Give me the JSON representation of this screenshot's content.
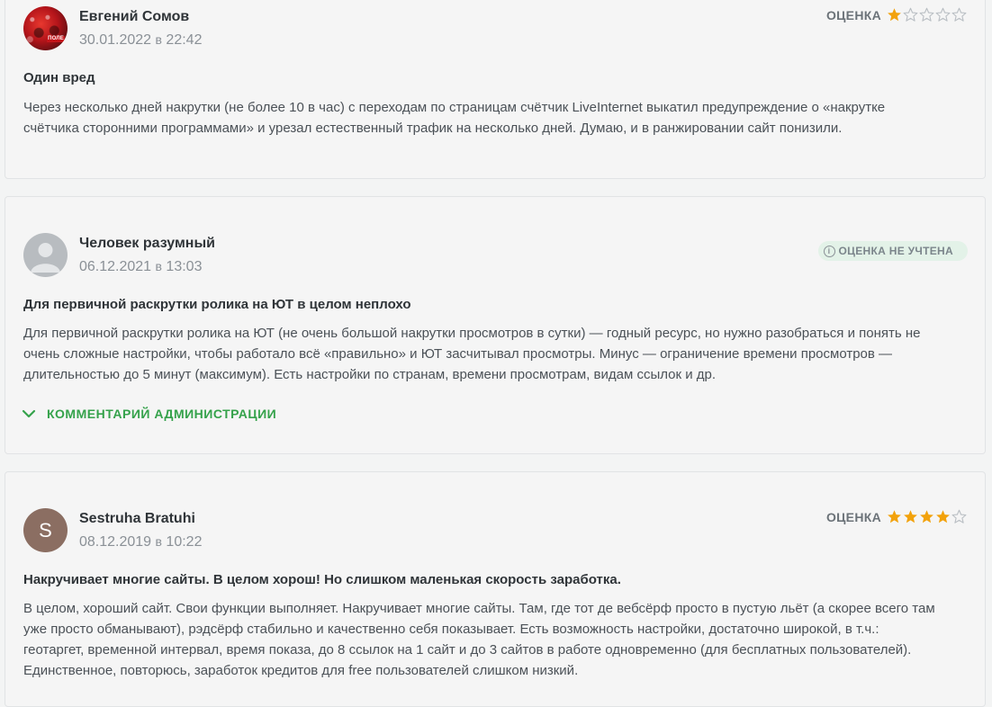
{
  "colors": {
    "star_filled": "#f2a20c",
    "star_empty": "#b9bec3",
    "accent_green": "#35a24b",
    "badge_bg": "#e3f2e8"
  },
  "reviews": [
    {
      "author": "Евгений Сомов",
      "date": "30.01.2022",
      "at": "в",
      "time": "22:42",
      "avatar": {
        "type": "photo",
        "logo_text": "ПОЛЕ"
      },
      "rating_label": "ОЦЕНКА",
      "rating": 1,
      "rating_max": 5,
      "title": "Один вред",
      "body": "Через несколько дней накрутки (не более 10 в час) с переходам по страницам счётчик LiveInternet выкатил предупреждение о «накрутке счётчика сторонними программами» и урезал естественный трафик на несколько дней. Думаю, и в ранжировании сайт понизили."
    },
    {
      "author": "Человек разумный",
      "date": "06.12.2021",
      "at": "в",
      "time": "13:03",
      "avatar": {
        "type": "anon"
      },
      "badge": "ОЦЕНКА НЕ УЧТЕНА",
      "badge_icon": "info-icon",
      "title": "Для первичной раскрутки ролика на ЮТ в целом неплохо",
      "body": "Для первичной раскрутки ролика на ЮТ (не очень большой накрутки просмотров в сутки) — годный ресурс, но нужно разобраться и понять не очень сложные настройки, чтобы работало всё «правильно» и ЮТ засчитывал просмотры. Минус — ограничение времени просмотров — длительностью до 5 минут (максимум). Есть настройки по странам, времени просмотрам, видам ссылок и др.",
      "admin_comment_label": "КОММЕНТАРИЙ АДМИНИСТРАЦИИ"
    },
    {
      "author": "Sestruha Bratuhi",
      "date": "08.12.2019",
      "at": "в",
      "time": "10:22",
      "avatar": {
        "type": "letter",
        "letter": "S"
      },
      "rating_label": "ОЦЕНКА",
      "rating": 4,
      "rating_max": 5,
      "title": "Накручивает многие сайты. В целом хорош! Но слишком маленькая скорость заработка.",
      "body": "В целом, хороший сайт. Свои функции выполняет. Накручивает многие сайты. Там, где тот де вебсёрф просто в пустую льёт (а скорее всего там уже просто обманывают), рэдсёрф стабильно и качественно себя показывает. Есть возможность настройки, достаточно широкой, в т.ч.: геотаргет, временной интервал, время показа, до 8 ссылок на 1 сайт и до 3 сайтов в работе одновременно (для бесплатных пользователей). Единственное, повторюсь, заработок кредитов для free пользователей слишком низкий."
    }
  ]
}
